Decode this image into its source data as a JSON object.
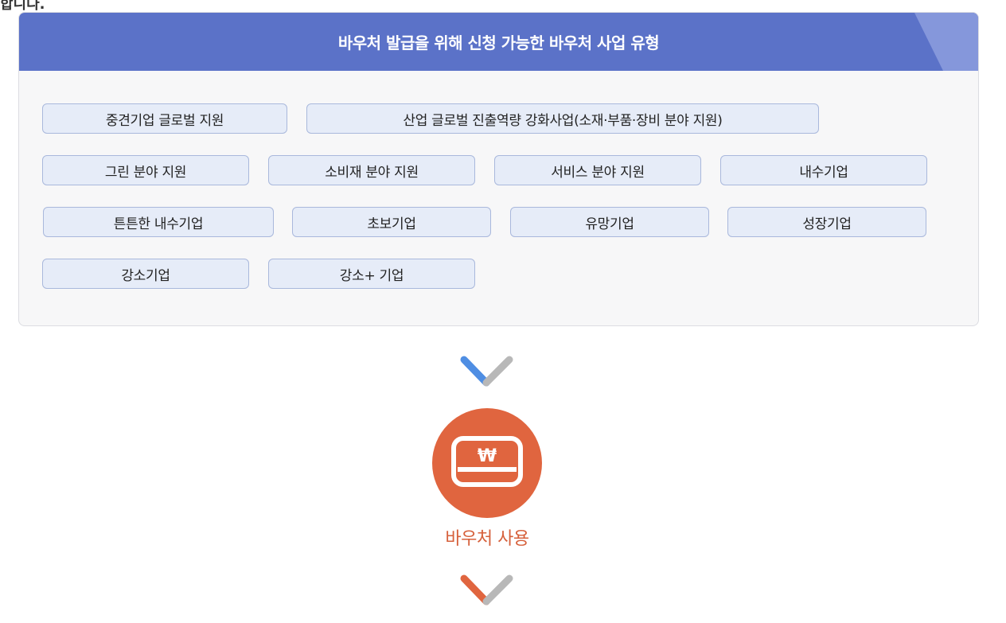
{
  "top_fragment": "합니다.",
  "panel": {
    "title": "바우처 발급을 위해 신청 가능한 바우처 사업 유형",
    "items": [
      "중견기업 글로벌 지원",
      "산업 글로벌 진출역량 강화사업(소재·부품·장비 분야 지원)",
      "그린 분야 지원",
      "소비재 분야 지원",
      "서비스 분야 지원",
      "내수기업",
      "튼튼한 내수기업",
      "초보기업",
      "유망기업",
      "성장기업",
      "강소기업",
      "강소+ 기업"
    ]
  },
  "step": {
    "label": "바우처 사용",
    "icon": "won-card-icon",
    "icon_symbol": "₩"
  },
  "colors": {
    "header_bg": "#5b72c8",
    "chip_bg": "#e6ecf8",
    "chip_border": "#a9b8dc",
    "step_circle": "#e0653f",
    "step_label": "#d6603b",
    "chevron_blue": "#4f8ee3",
    "chevron_orange": "#e0653f",
    "chevron_gray": "#b8b8b8"
  }
}
